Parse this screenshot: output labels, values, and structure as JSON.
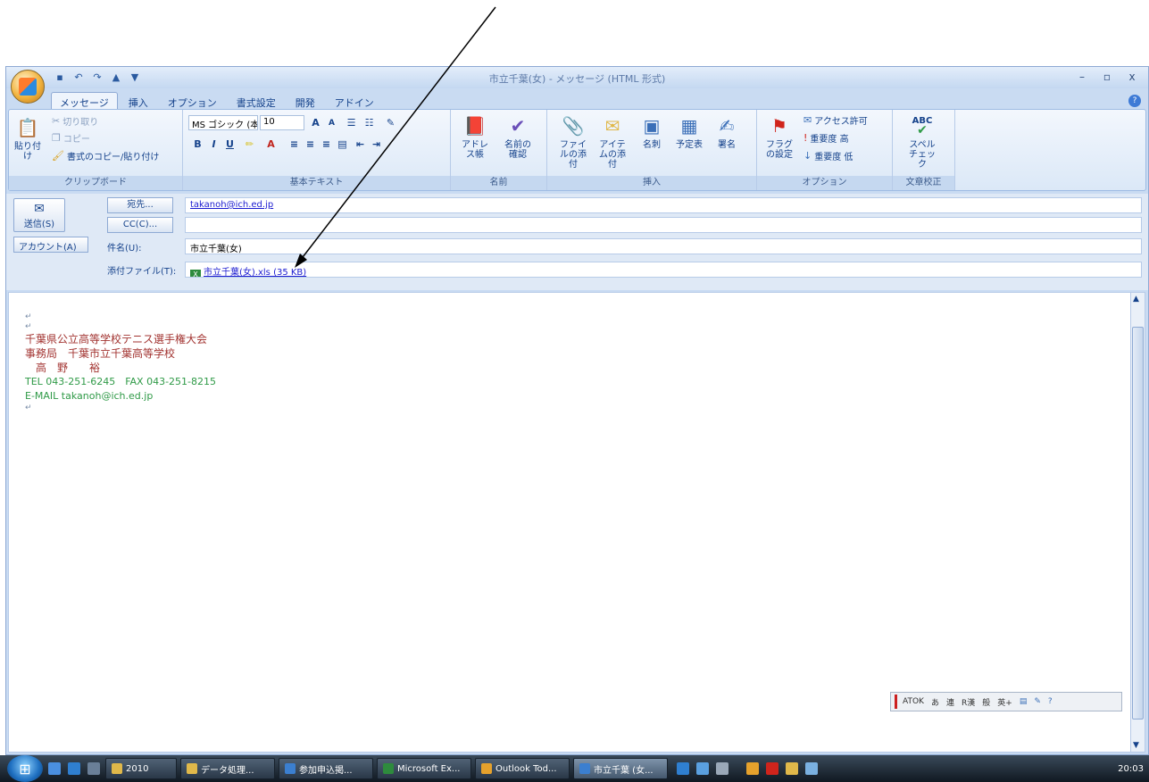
{
  "window": {
    "title": "市立千葉(女) - メッセージ (HTML 形式)",
    "qat": [
      "save",
      "undo",
      "redo",
      "up",
      "down"
    ],
    "controls": [
      "–",
      "▫",
      "x"
    ]
  },
  "ribbon": {
    "tabs": [
      "メッセージ",
      "挿入",
      "オプション",
      "書式設定",
      "開発",
      "アドイン"
    ],
    "active_tab": "メッセージ",
    "clipboard": {
      "paste": "貼り付け",
      "cut": "切り取り",
      "copy": "コピー",
      "format_painter": "書式のコピー/貼り付け",
      "label": "クリップボード"
    },
    "basic_text": {
      "font": "MS ゴシック (本",
      "size": "10",
      "label": "基本テキスト"
    },
    "names": {
      "address_book": "アドレス帳",
      "check_names": "名前の確認",
      "label": "名前"
    },
    "insert": {
      "attach_file": "ファイルの添付",
      "attach_item": "アイテムの添付",
      "business_card": "名刺",
      "calendar": "予定表",
      "signature": "署名",
      "label": "挿入"
    },
    "options": {
      "follow_up": "フラグの設定",
      "permission": "アクセス許可",
      "high": "重要度 高",
      "low": "重要度 低",
      "label": "オプション"
    },
    "proofing": {
      "spelling": "スペルチェック",
      "abc": "ABC",
      "label": "文章校正"
    }
  },
  "header": {
    "send": "送信(S)",
    "account": "アカウント(A)",
    "to_label": "宛先...",
    "to_value": "takanoh@ich.ed.jp",
    "cc_label": "CC(C)...",
    "cc_value": "",
    "subject_label": "件名(U):",
    "subject_value": "市立千葉(女)",
    "attach_label": "添付ファイル(T):",
    "attach_value": "市立千葉(女).xls (35 KB)"
  },
  "body": {
    "org": "千葉県公立高等学校テニス選手権大会",
    "office": "事務局　千葉市立千葉高等学校",
    "name": "高　野　　裕",
    "tel": "TEL 043-251-6245　FAX 043-251-8215",
    "email": "E-MAIL takanoh@ich.ed.jp"
  },
  "ime": [
    "ATOK",
    "あ",
    "連",
    "R漢",
    "般",
    "英+"
  ],
  "taskbar": {
    "items": [
      {
        "label": "2010",
        "color": "#e0b84a"
      },
      {
        "label": "データ処理...",
        "color": "#e0b84a"
      },
      {
        "label": "参加申込掲...",
        "color": "#3b7fd0"
      },
      {
        "label": "Microsoft Ex...",
        "color": "#2e8b3d"
      },
      {
        "label": "Outlook Tod...",
        "color": "#e5a12c"
      },
      {
        "label": "市立千葉 (女...",
        "color": "#3b7fd0"
      }
    ],
    "active_item": "市立千葉 (女...",
    "clock": "20:03"
  }
}
